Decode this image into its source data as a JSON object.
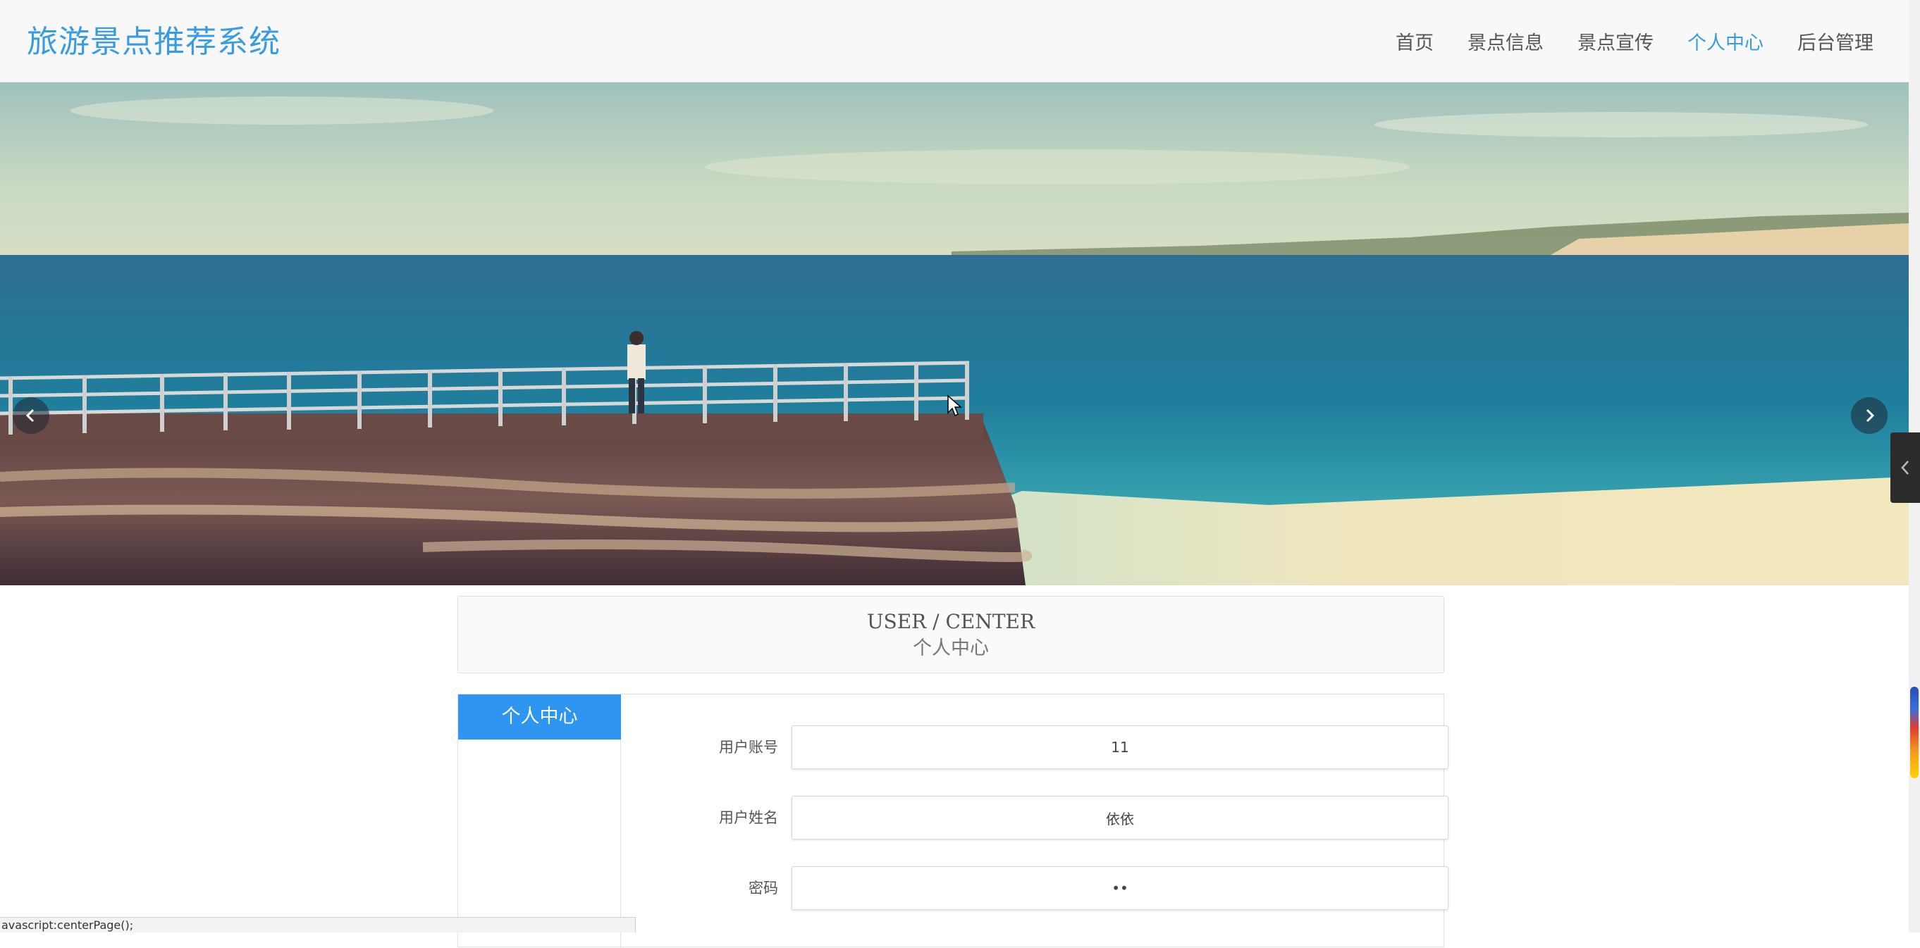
{
  "brand": {
    "title": "旅游景点推荐系统"
  },
  "nav": {
    "items": [
      {
        "label": "首页"
      },
      {
        "label": "景点信息"
      },
      {
        "label": "景点宣传"
      },
      {
        "label": "个人中心",
        "active": true
      },
      {
        "label": "后台管理"
      }
    ]
  },
  "banner": {
    "icons": {
      "prev": "chevron-left-icon",
      "next": "chevron-right-icon"
    }
  },
  "section_title": {
    "en": "USER / CENTER",
    "cn": "个人中心"
  },
  "sidebar": {
    "tab_label": "个人中心"
  },
  "form": {
    "fields": [
      {
        "label": "用户账号",
        "value": "11"
      },
      {
        "label": "用户姓名",
        "value": "依依"
      },
      {
        "label": "密码",
        "value": "••"
      }
    ]
  },
  "status_bar": {
    "text": "avascript:centerPage();"
  },
  "colors": {
    "accent": "#3a9ce0",
    "tab": "#2e96f0",
    "header_bg": "#f8f8f8"
  }
}
